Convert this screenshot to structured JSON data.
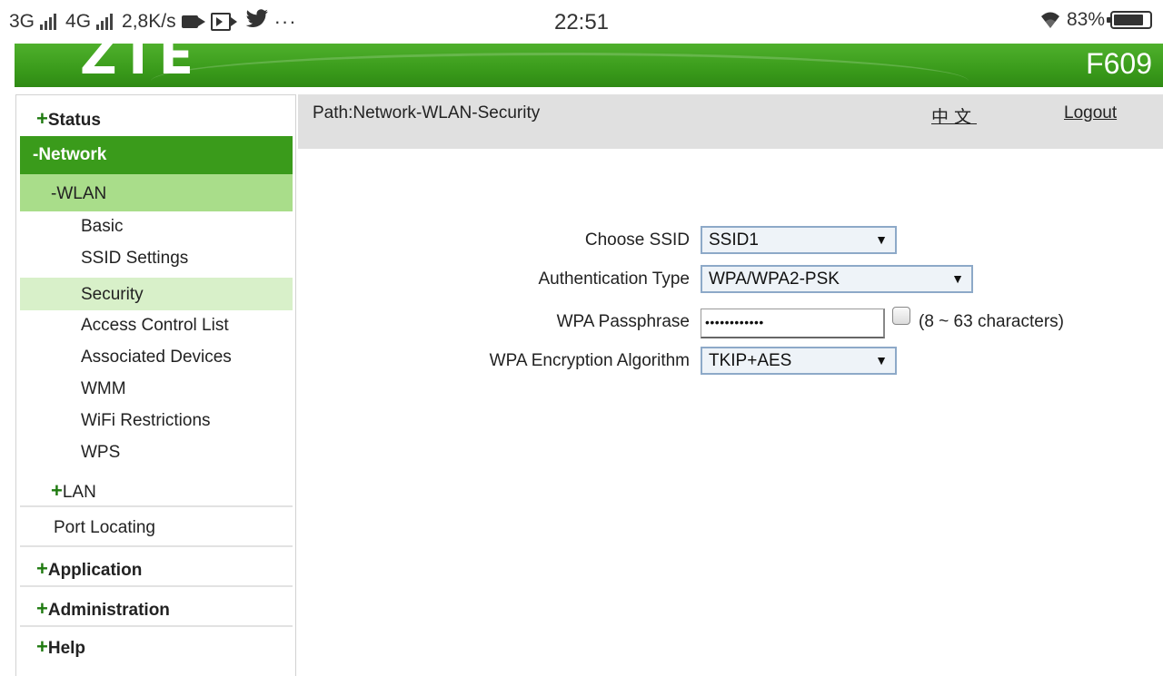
{
  "status_bar": {
    "net1": "3G",
    "net2": "4G",
    "speed": "2,8K/s",
    "more": "···",
    "clock": "22:51",
    "battery": "83%",
    "battery_level_percent": 83,
    "icons": [
      "signal-bars-icon",
      "video-camera-icon",
      "screen-record-icon",
      "twitter-bird-icon",
      "wifi-icon",
      "battery-icon"
    ]
  },
  "banner": {
    "logo": "ZTE",
    "model": "F609",
    "color": "#3a9b1b"
  },
  "sidebar": {
    "status": "Status",
    "network": "Network",
    "wlan": "WLAN",
    "wlan_items": [
      "Basic",
      "SSID Settings",
      "Security",
      "Access Control List",
      "Associated Devices",
      "WMM",
      "WiFi Restrictions",
      "WPS"
    ],
    "active_item": "Security",
    "lan": "LAN",
    "port_locating": "Port Locating",
    "application": "Application",
    "administration": "Administration",
    "help": "Help",
    "plus": "+",
    "minus": "-"
  },
  "pathbar": {
    "path": "Path:Network-WLAN-Security",
    "language": "中文",
    "logout": "Logout"
  },
  "form": {
    "ssid_label": "Choose SSID",
    "ssid_value": "SSID1",
    "auth_label": "Authentication Type",
    "auth_value": "WPA/WPA2-PSK",
    "pass_label": "WPA Passphrase",
    "pass_value": "••••••••••••",
    "pass_hint": "(8 ~ 63 characters)",
    "enc_label": "WPA Encryption Algorithm",
    "enc_value": "TKIP+AES",
    "dropdown_arrow": "▼"
  }
}
